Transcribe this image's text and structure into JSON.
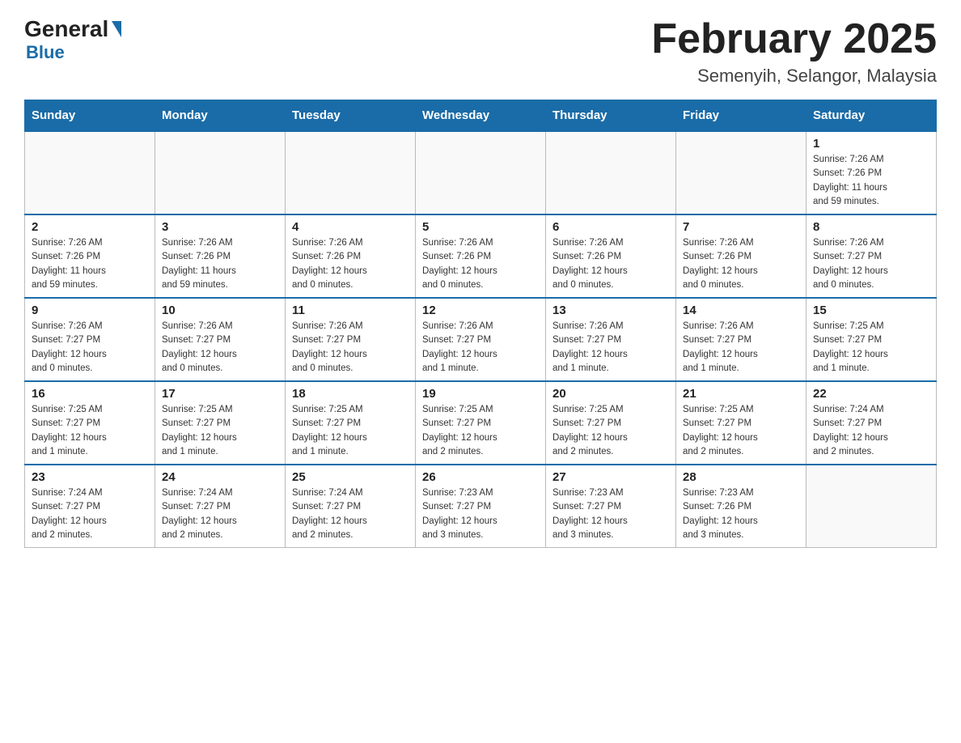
{
  "logo": {
    "name_part1": "General",
    "name_part2": "Blue"
  },
  "title": "February 2025",
  "subtitle": "Semenyih, Selangor, Malaysia",
  "weekdays": [
    "Sunday",
    "Monday",
    "Tuesday",
    "Wednesday",
    "Thursday",
    "Friday",
    "Saturday"
  ],
  "weeks": [
    [
      {
        "day": "",
        "info": ""
      },
      {
        "day": "",
        "info": ""
      },
      {
        "day": "",
        "info": ""
      },
      {
        "day": "",
        "info": ""
      },
      {
        "day": "",
        "info": ""
      },
      {
        "day": "",
        "info": ""
      },
      {
        "day": "1",
        "info": "Sunrise: 7:26 AM\nSunset: 7:26 PM\nDaylight: 11 hours\nand 59 minutes."
      }
    ],
    [
      {
        "day": "2",
        "info": "Sunrise: 7:26 AM\nSunset: 7:26 PM\nDaylight: 11 hours\nand 59 minutes."
      },
      {
        "day": "3",
        "info": "Sunrise: 7:26 AM\nSunset: 7:26 PM\nDaylight: 11 hours\nand 59 minutes."
      },
      {
        "day": "4",
        "info": "Sunrise: 7:26 AM\nSunset: 7:26 PM\nDaylight: 12 hours\nand 0 minutes."
      },
      {
        "day": "5",
        "info": "Sunrise: 7:26 AM\nSunset: 7:26 PM\nDaylight: 12 hours\nand 0 minutes."
      },
      {
        "day": "6",
        "info": "Sunrise: 7:26 AM\nSunset: 7:26 PM\nDaylight: 12 hours\nand 0 minutes."
      },
      {
        "day": "7",
        "info": "Sunrise: 7:26 AM\nSunset: 7:26 PM\nDaylight: 12 hours\nand 0 minutes."
      },
      {
        "day": "8",
        "info": "Sunrise: 7:26 AM\nSunset: 7:27 PM\nDaylight: 12 hours\nand 0 minutes."
      }
    ],
    [
      {
        "day": "9",
        "info": "Sunrise: 7:26 AM\nSunset: 7:27 PM\nDaylight: 12 hours\nand 0 minutes."
      },
      {
        "day": "10",
        "info": "Sunrise: 7:26 AM\nSunset: 7:27 PM\nDaylight: 12 hours\nand 0 minutes."
      },
      {
        "day": "11",
        "info": "Sunrise: 7:26 AM\nSunset: 7:27 PM\nDaylight: 12 hours\nand 0 minutes."
      },
      {
        "day": "12",
        "info": "Sunrise: 7:26 AM\nSunset: 7:27 PM\nDaylight: 12 hours\nand 1 minute."
      },
      {
        "day": "13",
        "info": "Sunrise: 7:26 AM\nSunset: 7:27 PM\nDaylight: 12 hours\nand 1 minute."
      },
      {
        "day": "14",
        "info": "Sunrise: 7:26 AM\nSunset: 7:27 PM\nDaylight: 12 hours\nand 1 minute."
      },
      {
        "day": "15",
        "info": "Sunrise: 7:25 AM\nSunset: 7:27 PM\nDaylight: 12 hours\nand 1 minute."
      }
    ],
    [
      {
        "day": "16",
        "info": "Sunrise: 7:25 AM\nSunset: 7:27 PM\nDaylight: 12 hours\nand 1 minute."
      },
      {
        "day": "17",
        "info": "Sunrise: 7:25 AM\nSunset: 7:27 PM\nDaylight: 12 hours\nand 1 minute."
      },
      {
        "day": "18",
        "info": "Sunrise: 7:25 AM\nSunset: 7:27 PM\nDaylight: 12 hours\nand 1 minute."
      },
      {
        "day": "19",
        "info": "Sunrise: 7:25 AM\nSunset: 7:27 PM\nDaylight: 12 hours\nand 2 minutes."
      },
      {
        "day": "20",
        "info": "Sunrise: 7:25 AM\nSunset: 7:27 PM\nDaylight: 12 hours\nand 2 minutes."
      },
      {
        "day": "21",
        "info": "Sunrise: 7:25 AM\nSunset: 7:27 PM\nDaylight: 12 hours\nand 2 minutes."
      },
      {
        "day": "22",
        "info": "Sunrise: 7:24 AM\nSunset: 7:27 PM\nDaylight: 12 hours\nand 2 minutes."
      }
    ],
    [
      {
        "day": "23",
        "info": "Sunrise: 7:24 AM\nSunset: 7:27 PM\nDaylight: 12 hours\nand 2 minutes."
      },
      {
        "day": "24",
        "info": "Sunrise: 7:24 AM\nSunset: 7:27 PM\nDaylight: 12 hours\nand 2 minutes."
      },
      {
        "day": "25",
        "info": "Sunrise: 7:24 AM\nSunset: 7:27 PM\nDaylight: 12 hours\nand 2 minutes."
      },
      {
        "day": "26",
        "info": "Sunrise: 7:23 AM\nSunset: 7:27 PM\nDaylight: 12 hours\nand 3 minutes."
      },
      {
        "day": "27",
        "info": "Sunrise: 7:23 AM\nSunset: 7:27 PM\nDaylight: 12 hours\nand 3 minutes."
      },
      {
        "day": "28",
        "info": "Sunrise: 7:23 AM\nSunset: 7:26 PM\nDaylight: 12 hours\nand 3 minutes."
      },
      {
        "day": "",
        "info": ""
      }
    ]
  ]
}
